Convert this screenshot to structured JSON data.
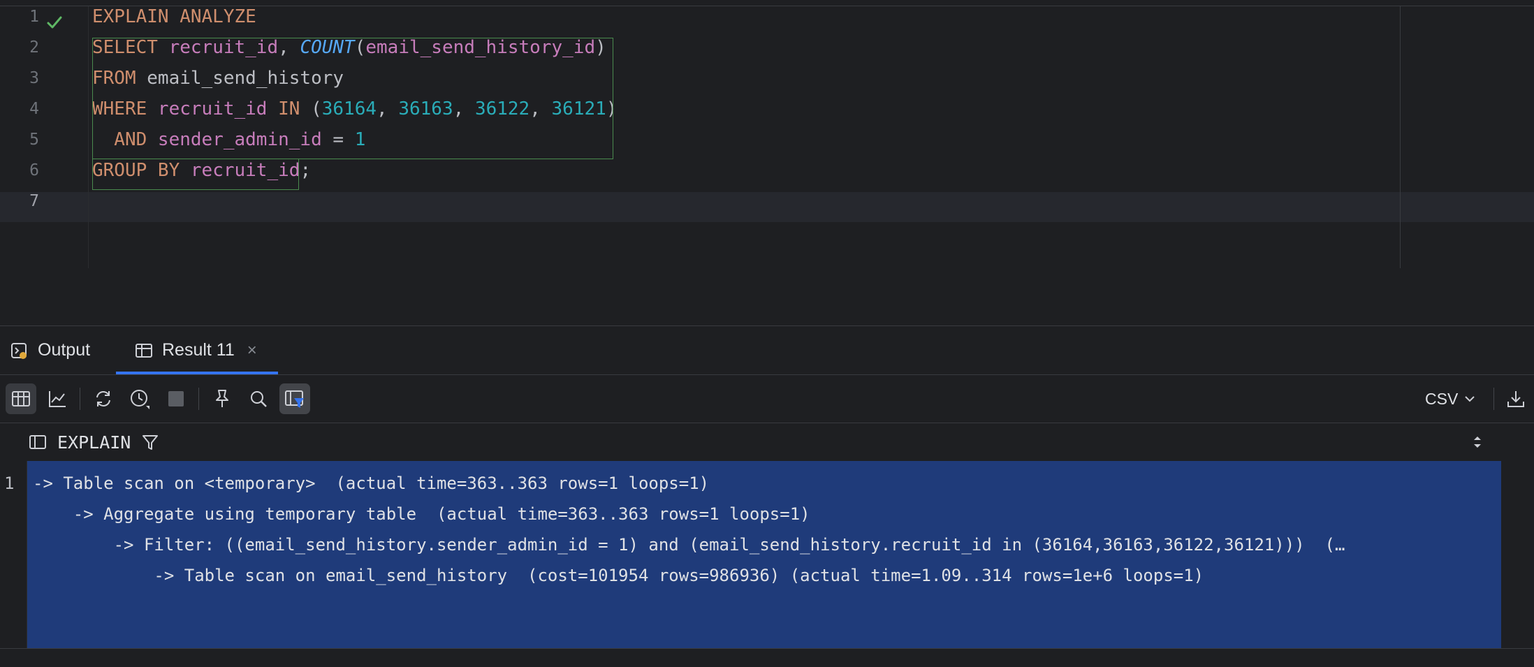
{
  "editor": {
    "line_numbers": [
      "1",
      "2",
      "3",
      "4",
      "5",
      "6",
      "7"
    ],
    "lines": [
      [
        {
          "t": "EXPLAIN ANALYZE",
          "c": "kw"
        }
      ],
      [
        {
          "t": "SELECT ",
          "c": "kw"
        },
        {
          "t": "recruit_id",
          "c": "id"
        },
        {
          "t": ", ",
          "c": "plain"
        },
        {
          "t": "COUNT",
          "c": "fn"
        },
        {
          "t": "(",
          "c": "plain"
        },
        {
          "t": "email_send_history_id",
          "c": "id"
        },
        {
          "t": ")",
          "c": "plain"
        }
      ],
      [
        {
          "t": "FROM ",
          "c": "kw"
        },
        {
          "t": "email_send_history",
          "c": "plain"
        }
      ],
      [
        {
          "t": "WHERE ",
          "c": "kw"
        },
        {
          "t": "recruit_id",
          "c": "id"
        },
        {
          "t": " IN ",
          "c": "kw"
        },
        {
          "t": "(",
          "c": "plain"
        },
        {
          "t": "36164",
          "c": "num"
        },
        {
          "t": ", ",
          "c": "plain"
        },
        {
          "t": "36163",
          "c": "num"
        },
        {
          "t": ", ",
          "c": "plain"
        },
        {
          "t": "36122",
          "c": "num"
        },
        {
          "t": ", ",
          "c": "plain"
        },
        {
          "t": "36121",
          "c": "num"
        },
        {
          "t": ")",
          "c": "plain"
        }
      ],
      [
        {
          "t": "  AND ",
          "c": "kw"
        },
        {
          "t": "sender_admin_id",
          "c": "id"
        },
        {
          "t": " = ",
          "c": "plain"
        },
        {
          "t": "1",
          "c": "num"
        }
      ],
      [
        {
          "t": "GROUP BY ",
          "c": "kw"
        },
        {
          "t": "recruit_id",
          "c": "id"
        },
        {
          "t": ";",
          "c": "plain"
        }
      ],
      []
    ],
    "current_line": "7",
    "status_icon": "checkmark-icon"
  },
  "panel": {
    "tabs": [
      {
        "label": "Output",
        "icon": "console-output-icon"
      },
      {
        "label": "Result 11",
        "icon": "table-icon",
        "close": "×",
        "active": true
      }
    ]
  },
  "toolbar": {
    "buttons": [
      "table-view-icon",
      "chart-view-icon",
      "refresh-icon",
      "history-icon",
      "stop-icon",
      "pin-icon",
      "search-icon",
      "filter-view-icon"
    ],
    "export_format": "CSV",
    "download_icon": "download-icon"
  },
  "grid": {
    "column": "EXPLAIN",
    "row_number": "1",
    "plan_lines": [
      "-> Table scan on <temporary>  (actual time=363..363 rows=1 loops=1)",
      "    -> Aggregate using temporary table  (actual time=363..363 rows=1 loops=1)",
      "        -> Filter: ((email_send_history.sender_admin_id = 1) and (email_send_history.recruit_id in (36164,36163,36122,36121)))  (…",
      "            -> Table scan on email_send_history  (cost=101954 rows=986936) (actual time=1.09..314 rows=1e+6 loops=1)"
    ]
  },
  "colors": {
    "background": "#1e1f22",
    "keyword": "#cf8e6d",
    "identifier": "#c77dbb",
    "function": "#56a8f5",
    "number": "#2aacb8",
    "selection": "#1f3b7a",
    "accent": "#3574f0",
    "check": "#5fb865"
  }
}
